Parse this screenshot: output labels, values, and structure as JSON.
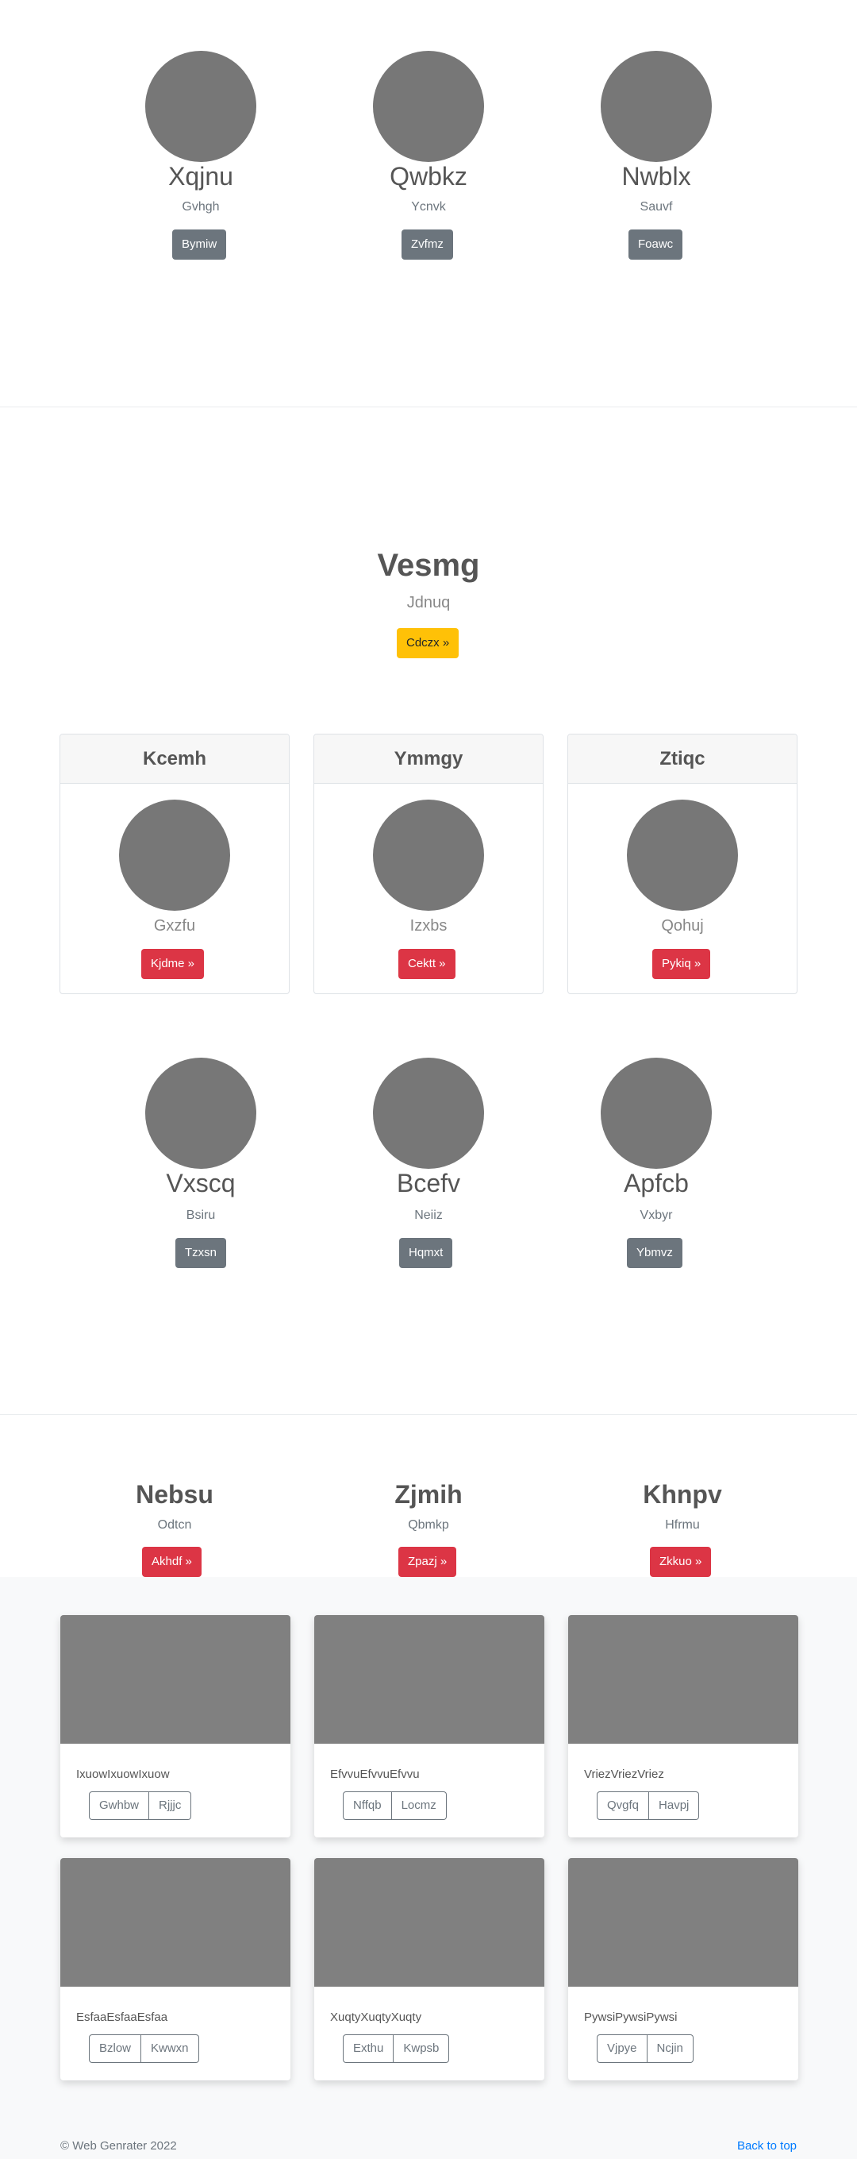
{
  "team_top": [
    {
      "name": "Xqjnu",
      "role": "Gvhgh",
      "button": "Bymiw"
    },
    {
      "name": "Qwbkz",
      "role": "Ycnvk",
      "button": "Zvfmz"
    },
    {
      "name": "Nwblx",
      "role": "Sauvf",
      "button": "Foawc"
    }
  ],
  "hero": {
    "title": "Vesmg",
    "subtitle": "Jdnuq",
    "button": "Cdczx »"
  },
  "header_cards": [
    {
      "header": "Kcemh",
      "sub": "Gxzfu",
      "button": "Kjdme »"
    },
    {
      "header": "Ymmgy",
      "sub": "Izxbs",
      "button": "Cektt »"
    },
    {
      "header": "Ztiqc",
      "sub": "Qohuj",
      "button": "Pykiq »"
    }
  ],
  "team_mid": [
    {
      "name": "Vxscq",
      "role": "Bsiru",
      "button": "Tzxsn"
    },
    {
      "name": "Bcefv",
      "role": "Neiiz",
      "button": "Hqmxt"
    },
    {
      "name": "Apfcb",
      "role": "Vxbyr",
      "button": "Ybmvz"
    }
  ],
  "features": [
    {
      "name": "Nebsu",
      "sub": "Odtcn",
      "button": "Akhdf »"
    },
    {
      "name": "Zjmih",
      "sub": "Qbmkp",
      "button": "Zpazj »"
    },
    {
      "name": "Khnpv",
      "sub": "Hfrmu",
      "button": "Zkkuo »"
    }
  ],
  "image_cards": [
    {
      "text": "IxuowIxuowIxuow",
      "btn1": "Gwhbw",
      "btn2": "Rjjjc"
    },
    {
      "text": "EfvvuEfvvuEfvvu",
      "btn1": "Nffqb",
      "btn2": "Locmz"
    },
    {
      "text": "VriezVriezVriez",
      "btn1": "Qvgfq",
      "btn2": "Havpj"
    },
    {
      "text": "EsfaaEsfaaEsfaa",
      "btn1": "Bzlow",
      "btn2": "Kwwxn"
    },
    {
      "text": "XuqtyXuqtyXuqty",
      "btn1": "Exthu",
      "btn2": "Kwpsb"
    },
    {
      "text": "PywsiPywsiPywsi",
      "btn1": "Vjpye",
      "btn2": "Ncjin"
    }
  ],
  "footer": {
    "copyright": "© Web Genrater 2022",
    "back_to_top": "Back to top"
  },
  "colors": {
    "gray_btn": "#6c757d",
    "red_btn": "#dc3545",
    "yellow_btn": "#ffc107",
    "link": "#007bff"
  }
}
